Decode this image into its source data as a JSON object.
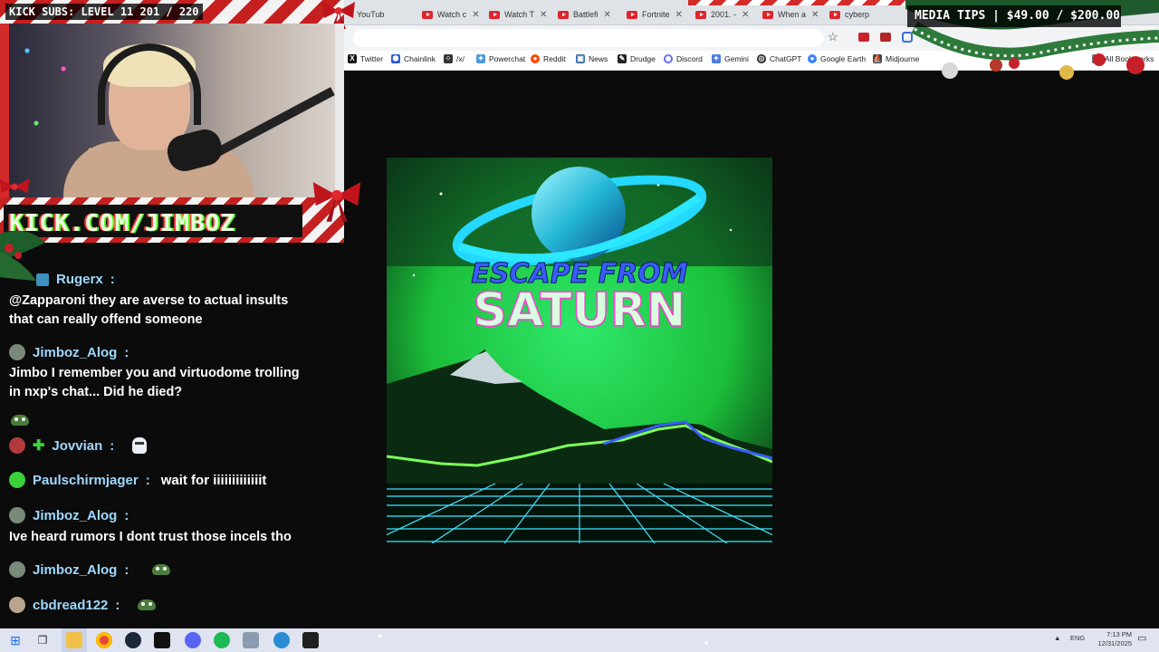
{
  "overlay": {
    "kick_subs": "KICK SUBS: LEVEL 11 201 / 220",
    "media_tips": "MEDIA TIPS | $49.00 / $200.00",
    "banner_text": "KICK.COM/JIMBOZ"
  },
  "browser": {
    "tabs": [
      {
        "label": "YouTub"
      },
      {
        "label": "Watch c"
      },
      {
        "label": "Watch T"
      },
      {
        "label": "Battlefi"
      },
      {
        "label": "Fortnite"
      },
      {
        "label": "2001. -"
      },
      {
        "label": "When a"
      },
      {
        "label": "cyberp"
      }
    ],
    "bookmarks": [
      {
        "label": "Twitter",
        "color": "#111111",
        "glyph": "X"
      },
      {
        "label": "Chainlink",
        "color": "#2a5ada",
        "glyph": "⬢"
      },
      {
        "label": "/x/",
        "color": "#333333",
        "glyph": "⁘"
      },
      {
        "label": "Powerchat",
        "color": "#4a9ce0",
        "glyph": "✦"
      },
      {
        "label": "Reddit",
        "color": "#ff4500",
        "glyph": "●"
      },
      {
        "label": "News",
        "color": "#3d6ea8",
        "glyph": "▣"
      },
      {
        "label": "Drudge",
        "color": "#222222",
        "glyph": "✎"
      },
      {
        "label": "Discord",
        "color": "#5865f2",
        "glyph": "◉"
      },
      {
        "label": "Gemini",
        "color": "#4a7be0",
        "glyph": "✦"
      },
      {
        "label": "ChatGPT",
        "color": "#1f1f1f",
        "glyph": "◎"
      },
      {
        "label": "Google Earth",
        "color": "#3b82f6",
        "glyph": "●"
      },
      {
        "label": "Midjourne",
        "color": "#444444",
        "glyph": "⛵"
      },
      {
        "label": "All Bookmarks",
        "color": "#666666",
        "glyph": "▤"
      }
    ]
  },
  "chat": {
    "messages": [
      {
        "username": "Rugerx",
        "text": "@Zapparoni they are averse to actual insults that can really offend someone",
        "avatar_color": "#3f8fbf"
      },
      {
        "username": "Jimboz_Alog",
        "text": "Jimbo I remember you and virtuodome trolling in nxp's chat... Did he died?",
        "avatar_color": "#7a8a7a"
      },
      {
        "username": "Jovvian",
        "text": "",
        "avatar_color": "#b33a3a"
      },
      {
        "username": "Paulschirmjager",
        "text": "wait for iiiiiiiiiiiiit",
        "avatar_color": "#3ad13a"
      },
      {
        "username": "Jimboz_Alog",
        "text": "Ive heard rumors I dont trust those incels tho",
        "avatar_color": "#7a8a7a"
      },
      {
        "username": "Jimboz_Alog",
        "text": "",
        "avatar_color": "#7a8a7a"
      },
      {
        "username": "cbdread122",
        "text": "",
        "avatar_color": "#b9a38c"
      }
    ]
  },
  "album": {
    "title_line1": "ESCAPE FROM",
    "title_line2": "SATURN"
  },
  "system": {
    "lang": "ENG",
    "time": "7:13 PM",
    "date": "12/31/2025"
  }
}
